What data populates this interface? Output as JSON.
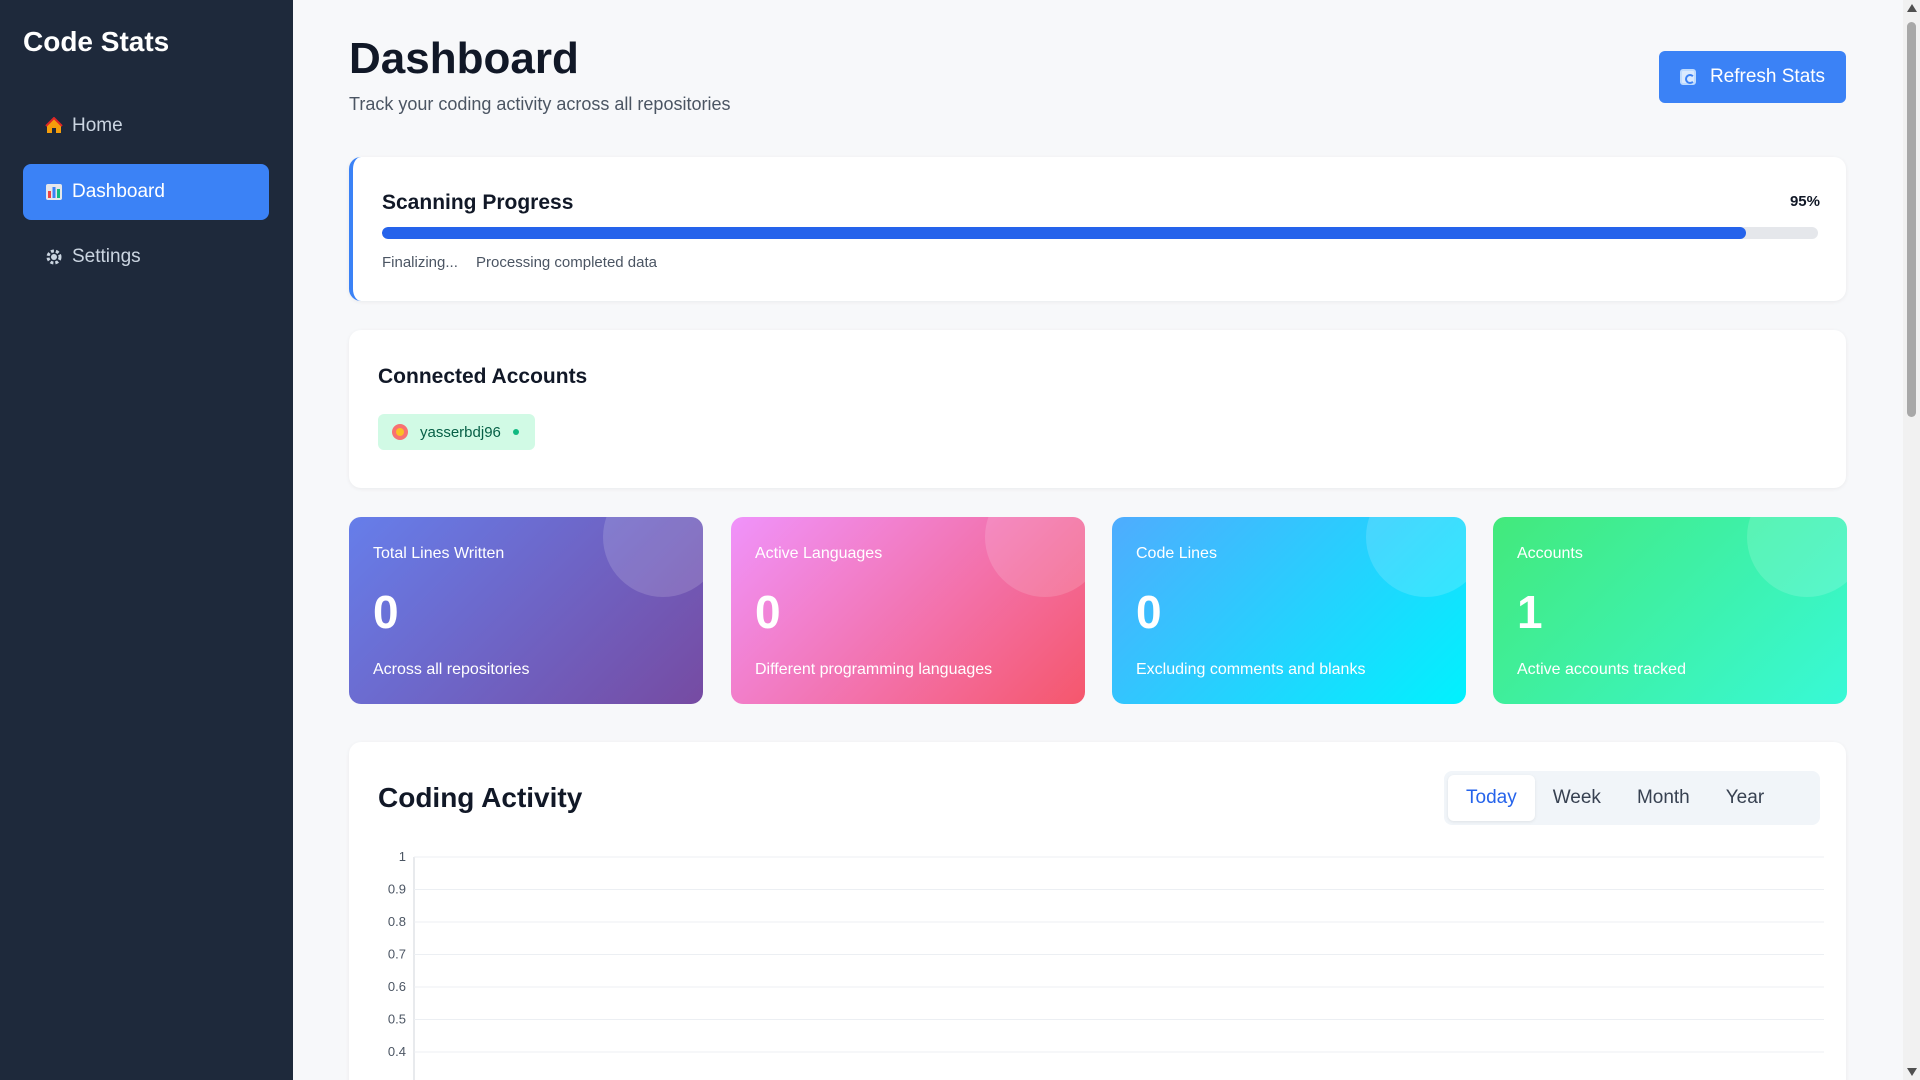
{
  "sidebar": {
    "brand": "Code Stats",
    "items": [
      {
        "label": "Home",
        "icon": "house-icon",
        "active": false
      },
      {
        "label": "Dashboard",
        "icon": "bar-chart-icon",
        "active": true
      },
      {
        "label": "Settings",
        "icon": "gear-icon",
        "active": false
      }
    ]
  },
  "header": {
    "title": "Dashboard",
    "subtitle": "Track your coding activity across all repositories",
    "refresh_label": "Refresh Stats"
  },
  "scan": {
    "title": "Scanning Progress",
    "percent_label": "95%",
    "progress": 0.95,
    "stage": "Finalizing...",
    "detail": "Processing completed data"
  },
  "accounts": {
    "title": "Connected Accounts",
    "items": [
      {
        "name": "yasserbdj96",
        "status": "connected"
      }
    ]
  },
  "stats": [
    {
      "label": "Total Lines Written",
      "value": "0",
      "note": "Across all repositories"
    },
    {
      "label": "Active Languages",
      "value": "0",
      "note": "Different programming languages"
    },
    {
      "label": "Code Lines",
      "value": "0",
      "note": "Excluding comments and blanks"
    },
    {
      "label": "Accounts",
      "value": "1",
      "note": "Active accounts tracked"
    }
  ],
  "activity": {
    "title": "Coding Activity",
    "periods": [
      "Today",
      "Week",
      "Month",
      "Year"
    ],
    "selected_period": "Today"
  },
  "chart_data": {
    "type": "line",
    "title": "",
    "xlabel": "",
    "ylabel": "",
    "yticks": [
      "1",
      "0.9",
      "0.8",
      "0.7",
      "0.6",
      "0.5",
      "0.4"
    ],
    "ylim": [
      0,
      1
    ],
    "grid": true,
    "series": []
  },
  "colors": {
    "accent": "#3b82f6",
    "sidebar_bg": "#1e293b",
    "progress": "#2563eb",
    "connected_dot": "#10b981"
  }
}
